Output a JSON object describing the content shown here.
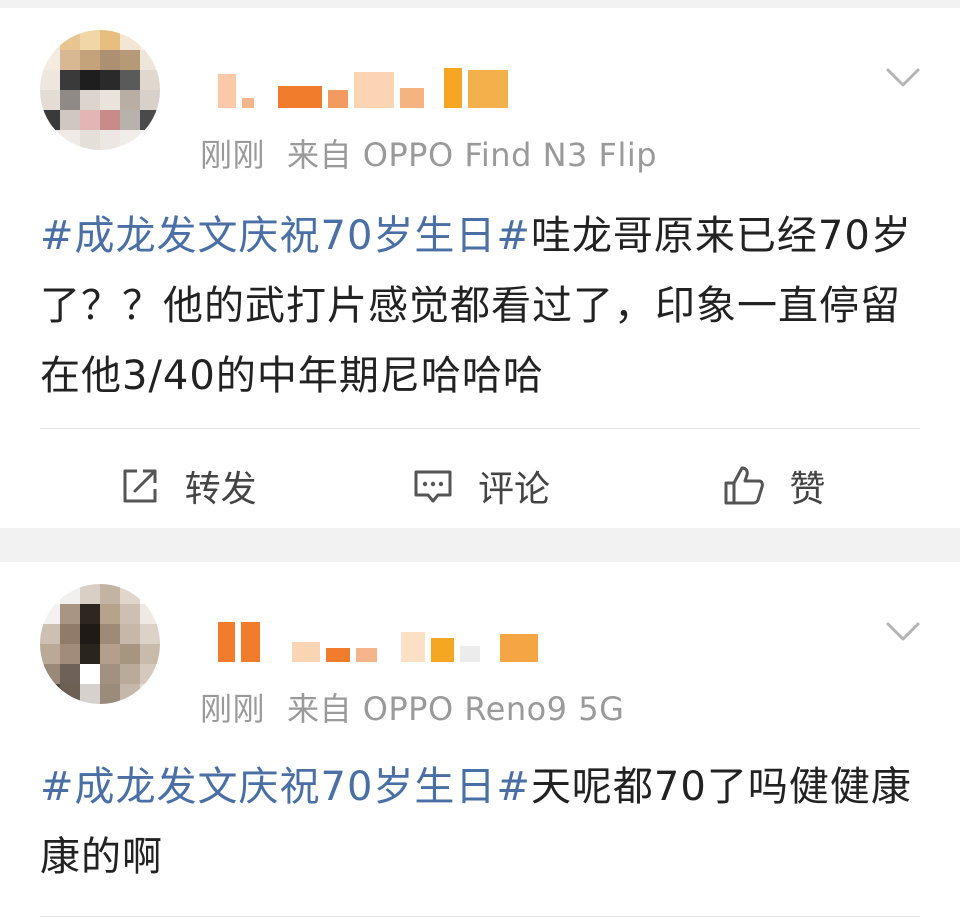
{
  "posts": [
    {
      "time": "刚刚",
      "source": "来自 OPPO Find N3 Flip",
      "hashtag": "#成龙发文庆祝70岁生日#",
      "text": "哇龙哥原来已经70岁了？？他的武打片感觉都看过了，印象一直停留在他3/40的中年期尼哈哈哈",
      "actions": {
        "repost": "转发",
        "comment": "评论",
        "like": "赞"
      }
    },
    {
      "time": "刚刚",
      "source": "来自 OPPO Reno9 5G",
      "hashtag": "#成龙发文庆祝70岁生日#",
      "text": "天呢都70了吗健健康康的啊"
    }
  ],
  "icons": {
    "more": "chevron-down-icon",
    "repost": "repost-icon",
    "comment": "comment-icon",
    "like": "thumbs-up-icon"
  },
  "colors": {
    "hashtag": "#4a6fa5",
    "meta": "#9a9a9a",
    "text": "#222222",
    "background": "#f2f2f2"
  }
}
